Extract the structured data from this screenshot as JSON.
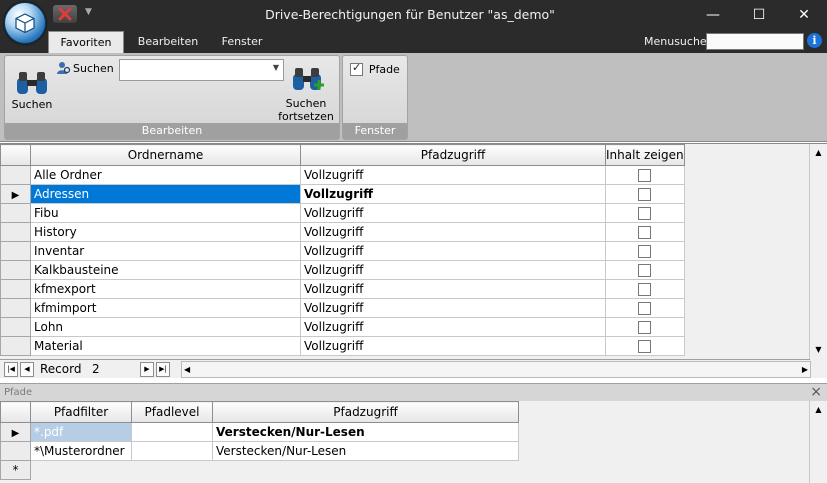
{
  "window": {
    "title": "Drive-Berechtigungen für Benutzer \"as_demo\"",
    "minimize_glyph": "—",
    "maximize_glyph": "☐",
    "close_glyph": "✕"
  },
  "ribbon_tabs": [
    {
      "label": "Favoriten",
      "active": true
    },
    {
      "label": "Bearbeiten",
      "active": false
    },
    {
      "label": "Fenster",
      "active": false
    }
  ],
  "menusuche": {
    "label": "Menusuche",
    "value": "",
    "info_glyph": "i"
  },
  "ribbon": {
    "bearbeiten_group": {
      "label": "Bearbeiten",
      "suchen_button": "Suchen",
      "suchen_small_label": "Suchen",
      "suchen_combo_value": "",
      "fortsetzen_line1": "Suchen",
      "fortsetzen_line2": "fortsetzen"
    },
    "fenster_group": {
      "label": "Fenster",
      "pfade_label": "Pfade",
      "pfade_checked": true
    }
  },
  "folders_grid": {
    "columns": [
      "Ordnername",
      "Pfadzugriff",
      "Inhalt zeigen"
    ],
    "rows": [
      {
        "name": "Alle Ordner",
        "access": "Vollzugriff",
        "show": false
      },
      {
        "name": "Adressen",
        "access": "Vollzugriff",
        "show": false
      },
      {
        "name": "Fibu",
        "access": "Vollzugriff",
        "show": false
      },
      {
        "name": "History",
        "access": "Vollzugriff",
        "show": false
      },
      {
        "name": "Inventar",
        "access": "Vollzugriff",
        "show": false
      },
      {
        "name": "Kalkbausteine",
        "access": "Vollzugriff",
        "show": false
      },
      {
        "name": "kfmexport",
        "access": "Vollzugriff",
        "show": false
      },
      {
        "name": "kfmimport",
        "access": "Vollzugriff",
        "show": false
      },
      {
        "name": "Lohn",
        "access": "Vollzugriff",
        "show": false
      },
      {
        "name": "Material",
        "access": "Vollzugriff",
        "show": false
      }
    ],
    "navigator": {
      "record_label": "Record",
      "record_number": "2"
    }
  },
  "paths_pane": {
    "title": "Pfade",
    "close_glyph": "×",
    "columns": [
      "Pfadfilter",
      "Pfadlevel",
      "Pfadzugriff"
    ],
    "rows": [
      {
        "filter": "*.pdf",
        "level": "",
        "access": "Verstecken/Nur-Lesen"
      },
      {
        "filter": "*\\Musterordner",
        "level": "",
        "access": "Verstecken/Nur-Lesen"
      }
    ],
    "new_row_glyph": "*"
  },
  "icons": [
    "app-orb-icon",
    "quick-access-close-icon",
    "binoculars-icon",
    "user-search-icon",
    "binoculars-plus-icon",
    "info-icon",
    "row-selector-arrow-icon"
  ]
}
